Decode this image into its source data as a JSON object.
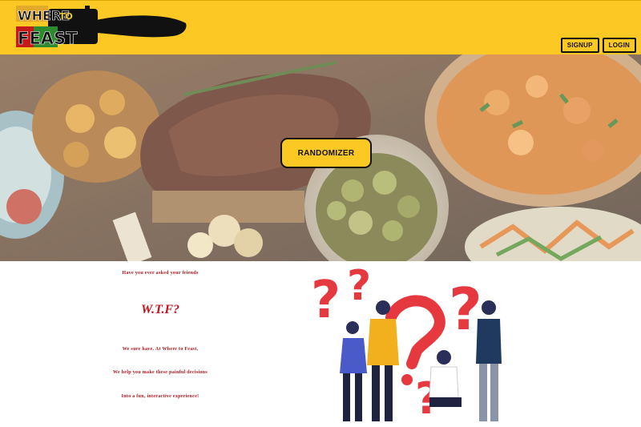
{
  "header": {
    "logo": {
      "line1": "WHERE",
      "line2": "TO",
      "line3": "FEAST",
      "icon": "fork-icon"
    },
    "signup_label": "SIGNUP",
    "login_label": "LOGIN"
  },
  "hero": {
    "randomizer_label": "RANDOMIZER"
  },
  "intro": {
    "line1": "Have you ever asked your friends",
    "wtf": "W.T.F?",
    "line2": "We sure have. At Where to Feast,",
    "line3": "We help you make these painful decisions",
    "line4": "Into a fun, interactive experience!"
  },
  "colors": {
    "brand_yellow": "#fcc924",
    "accent_red": "#c4141d",
    "text_dark": "#111111"
  }
}
